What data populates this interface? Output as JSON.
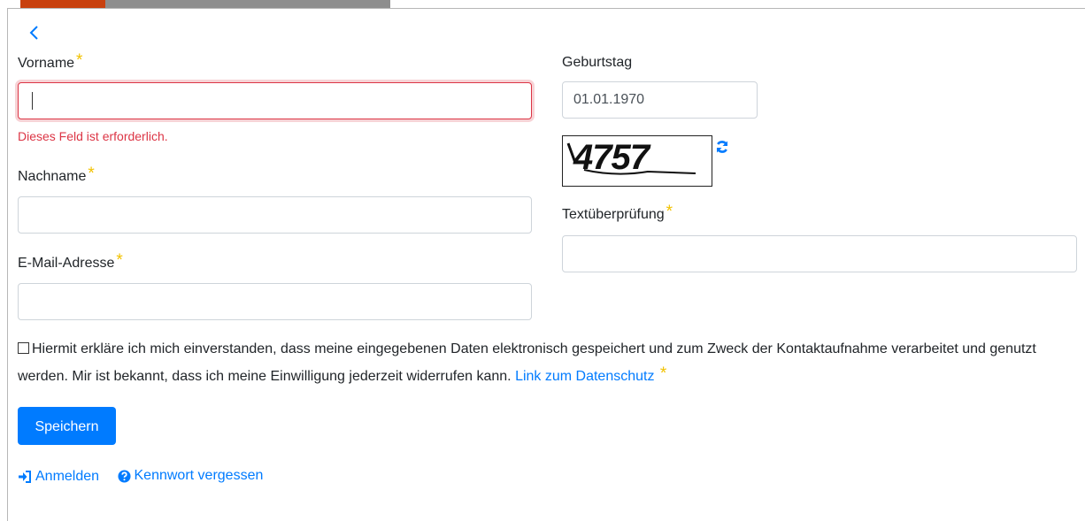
{
  "form": {
    "vorname_label": "Vorname",
    "nachname_label": "Nachname",
    "email_label": "E-Mail-Adresse",
    "geburtstag_label": "Geburtstag",
    "geburtstag_value": "01.01.1970",
    "textpruefung_label": "Textüberprüfung",
    "error_required": "Dieses Feld ist erforderlich.",
    "required_marker": "*",
    "captcha_text": "4757",
    "consent_text": "Hiermit erkläre ich mich einverstanden, dass meine eingegebenen Daten elektronisch gespeichert und zum Zweck der Kontaktaufnahme verarbeitet und genutzt werden. Mir ist bekannt, dass ich meine Einwilligung jederzeit widerrufen kann.",
    "privacy_link": "Link zum Datenschutz",
    "save_label": "Speichern"
  },
  "footer": {
    "login_label": "Anmelden",
    "forgot_label": "Kennwort vergessen"
  },
  "icons": {
    "back": "chevron-left-icon",
    "refresh": "refresh-icon",
    "login": "sign-in-icon",
    "help": "question-circle-icon"
  },
  "colors": {
    "primary": "#007bff",
    "error": "#dc3545",
    "required": "#f2c200",
    "tab_active": "#c8410f",
    "tab_inactive": "#8e8e8e"
  }
}
